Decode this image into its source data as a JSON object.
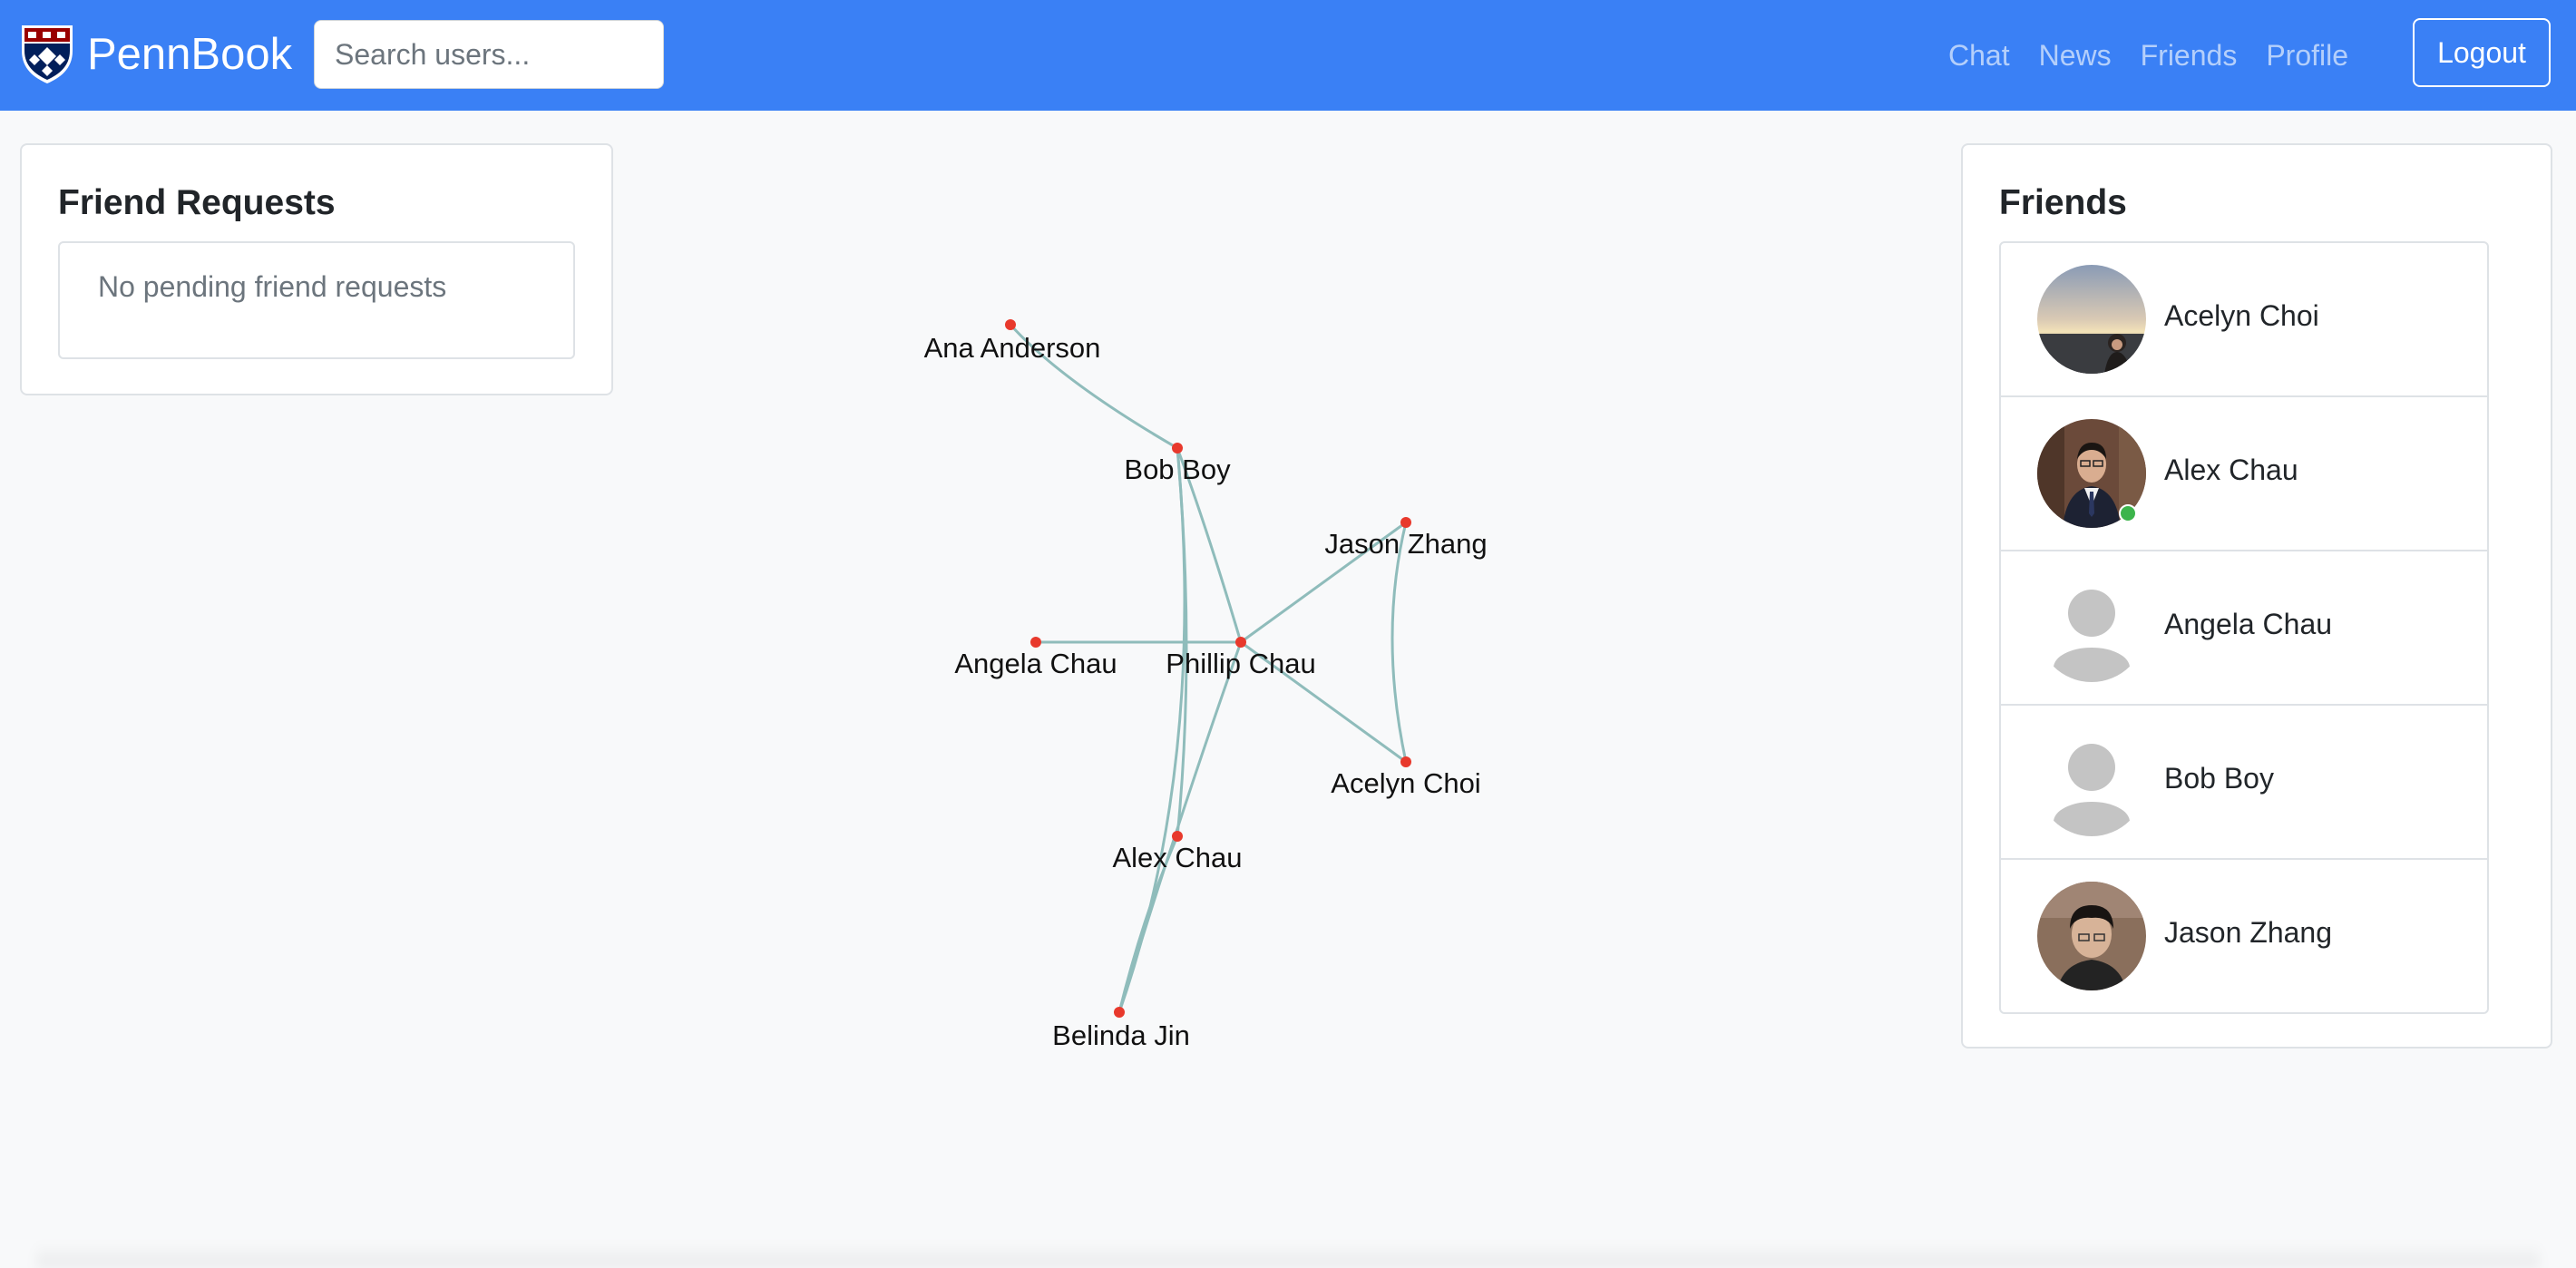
{
  "navbar": {
    "brand": "PennBook",
    "search_placeholder": "Search users...",
    "links": [
      "Chat",
      "News",
      "Friends",
      "Profile"
    ],
    "logout_label": "Logout",
    "bg_color": "#3a80f5"
  },
  "friend_requests": {
    "title": "Friend Requests",
    "empty_text": "No pending friend requests"
  },
  "friends": {
    "title": "Friends",
    "items": [
      {
        "name": "Acelyn Choi",
        "avatar": "photo-sunset",
        "online": false
      },
      {
        "name": "Alex Chau",
        "avatar": "photo-suit",
        "online": true
      },
      {
        "name": "Angela Chau",
        "avatar": "default-user-icon",
        "online": false
      },
      {
        "name": "Bob Boy",
        "avatar": "default-user-icon",
        "online": false
      },
      {
        "name": "Jason Zhang",
        "avatar": "photo-portrait",
        "online": false
      }
    ]
  },
  "graph": {
    "nodes": [
      "Ana Anderson",
      "Bob Boy",
      "Jason Zhang",
      "Angela Chau",
      "Phillip Chau",
      "Acelyn Choi",
      "Alex Chau",
      "Belinda Jin"
    ],
    "edges": [
      [
        "Ana Anderson",
        "Bob Boy"
      ],
      [
        "Bob Boy",
        "Phillip Chau"
      ],
      [
        "Bob Boy",
        "Alex Chau"
      ],
      [
        "Bob Boy",
        "Belinda Jin"
      ],
      [
        "Angela Chau",
        "Phillip Chau"
      ],
      [
        "Phillip Chau",
        "Jason Zhang"
      ],
      [
        "Phillip Chau",
        "Acelyn Choi"
      ],
      [
        "Phillip Chau",
        "Belinda Jin"
      ],
      [
        "Jason Zhang",
        "Acelyn Choi"
      ],
      [
        "Alex Chau",
        "Belinda Jin"
      ]
    ],
    "node_color": "#e8392c",
    "edge_color": "#8fbcbb"
  }
}
